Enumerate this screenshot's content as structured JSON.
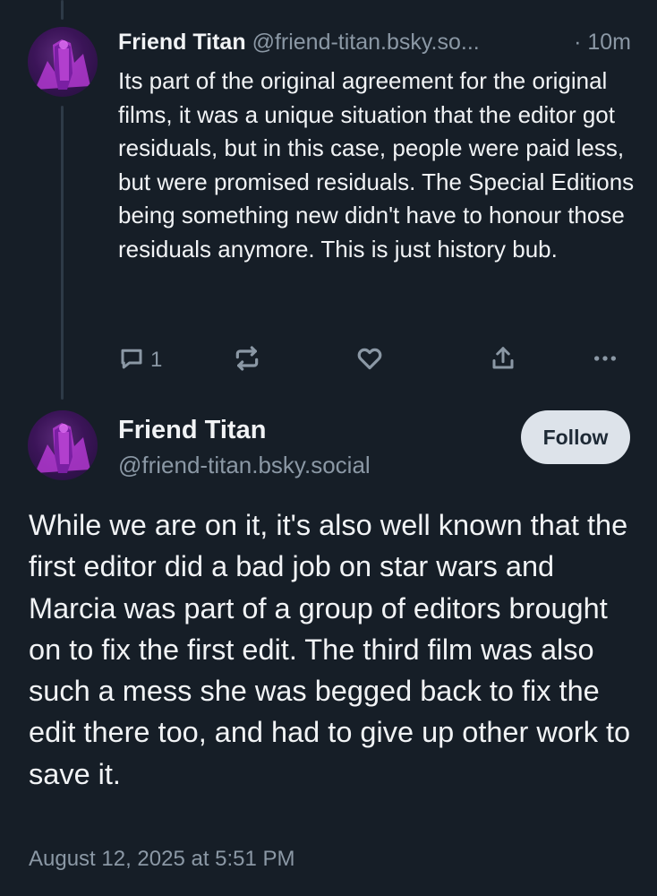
{
  "reply_post": {
    "author_name": "Friend Titan",
    "author_handle": "@friend-titan.bsky.so...",
    "time": "· 10m",
    "text": "Its part of the original agreement for the original films, it was a unique situation that the editor got residuals, but in this case, people were paid less, but were promised residuals. The Special Editions being something new didn't have to honour those residuals anymore. This is just history bub.",
    "reply_count": "1",
    "icons": {
      "reply": "speech-bubble-icon",
      "repost": "repost-arrows-icon",
      "like": "heart-icon",
      "share": "share-upload-icon",
      "more": "more-dots-icon"
    }
  },
  "main_post": {
    "author_name": "Friend Titan",
    "author_handle": "@friend-titan.bsky.social",
    "follow_label": "Follow",
    "text": "While we are on it, it's also well known that the first editor did a bad job on star wars and Marcia was part of a group of editors brought on to fix the first edit. The third film was also such a mess she was begged back to fix the edit there too, and had to give up other work to save it.",
    "timestamp": "August 12, 2025 at 5:51 PM"
  },
  "colors": {
    "background": "#161e27",
    "text": "#f1f3f5",
    "muted": "#8b98a5",
    "follow_bg": "#dde3ea",
    "thread_line": "#2e3a47"
  }
}
